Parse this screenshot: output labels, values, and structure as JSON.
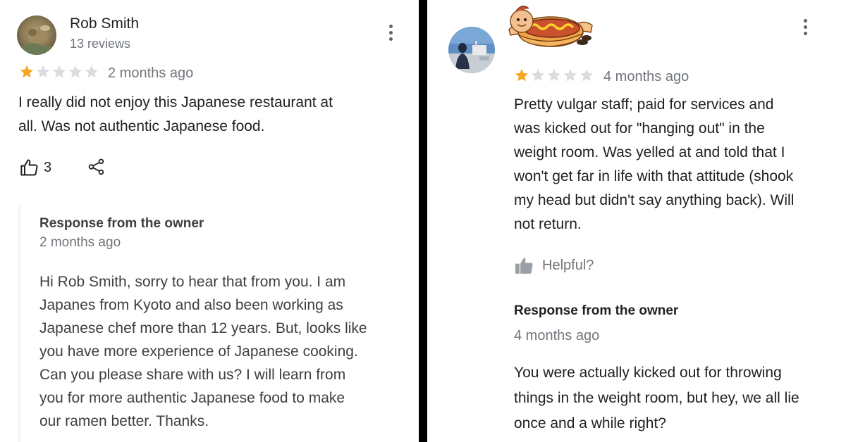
{
  "left_review": {
    "reviewer": {
      "name": "Rob Smith",
      "meta": "13 reviews"
    },
    "rating": 1,
    "max_rating": 5,
    "date": "2 months ago",
    "text_lines": [
      "I really did not enjoy this Japanese restaurant at",
      "all. Was not authentic Japanese food."
    ],
    "like_count": "3",
    "owner_response": {
      "title": "Response from the owner",
      "date": "2 months ago",
      "text_lines": [
        "Hi Rob Smith, sorry to hear that from you. I am",
        "Japanes from Kyoto and also been working as",
        "Japanese chef more than 12 years. But, looks like",
        "you have more experience of Japanese cooking.",
        "Can you please share with us? I will learn from",
        "you for more authentic Japanese food to make",
        "our ramen better. Thanks."
      ]
    }
  },
  "right_review": {
    "rating": 1,
    "max_rating": 5,
    "date": "4 months ago",
    "text_lines": [
      "Pretty vulgar staff; paid for services and",
      "was kicked out for \"hanging out\" in the",
      "weight room. Was yelled at and told that I",
      "won't get far in life with that attitude (shook",
      "my head but didn't say anything back). Will",
      "not return."
    ],
    "helpful_label": "Helpful?",
    "owner_response": {
      "title": "Response from the owner",
      "date": "4 months ago",
      "text_lines": [
        "You were actually kicked out for throwing",
        "things in the weight room, but hey, we all lie",
        "once and a while right?"
      ]
    }
  },
  "colors": {
    "star_filled": "#f5a623",
    "star_empty": "#dadce0",
    "divider": "#000000",
    "text_primary": "#202124",
    "text_secondary": "#70757a"
  },
  "icons": {
    "more": "more-vert-icon",
    "like": "thumb-up-outline-icon",
    "share": "share-icon",
    "helpful": "thumb-up-filled-icon",
    "star": "star-icon",
    "sticker": "hot-dog-costume-sticker"
  }
}
